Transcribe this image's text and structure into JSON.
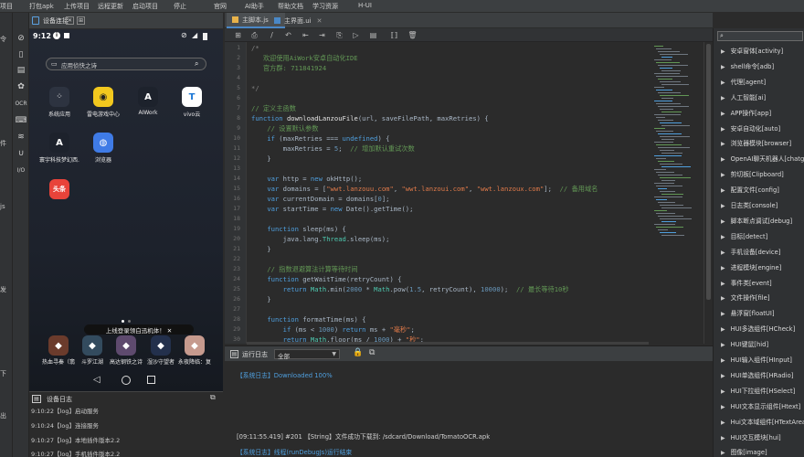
{
  "menubar": {
    "items": [
      "项目",
      "打包apk",
      "上传项目",
      "远程更新",
      "启动项目",
      "停止",
      "官网",
      "AI助手",
      "帮助文档",
      "学习资源",
      "H-UI"
    ]
  },
  "left_edge": [
    "令",
    "件",
    "js",
    "发",
    "下",
    "出"
  ],
  "device": {
    "tab_label": "设备连接",
    "status_time": "9:12",
    "search_placeholder": "应用侦快之诗",
    "apps": [
      {
        "label": "系统应用",
        "icon": "grid-icon",
        "color": "#2d3340"
      },
      {
        "label": "雷电游戏中心",
        "icon": "gamepad-icon",
        "color": "#f2c81e"
      },
      {
        "label": "AIWork",
        "icon": "avengers-icon",
        "color": "#1d222c"
      },
      {
        "label": "vivo云",
        "icon": "cloud-icon",
        "color": "#ffffff"
      },
      {
        "label": "寰宇科技梦幻西...",
        "icon": "avengers-icon",
        "color": "#1d222c"
      },
      {
        "label": "浏览器",
        "icon": "globe-icon",
        "color": "#3f7be6"
      },
      {
        "label": "",
        "icon": "toutiao-icon",
        "color": "#e8433a"
      }
    ],
    "toutiao_text": "头条",
    "dock_apps": [
      "热血寻秦（翡",
      "斗罗江湖",
      "高达钢铁之诗",
      "湿沙守望者",
      "永夜降临：复"
    ],
    "toast": "上线登录领白迅机体！ ✕",
    "log": {
      "title": "设备日志",
      "rows": [
        "9:10:22【log】启动服务",
        "9:10:24【log】连接服务",
        "9:10:27【log】本地插件版本2.2",
        "9:10:27【log】手机插件版本2.2"
      ]
    }
  },
  "editor": {
    "tabs": [
      {
        "label": "主脚本.js",
        "active": true
      },
      {
        "label": "主界面.ui",
        "active": false
      }
    ],
    "line_numbers": [
      "1",
      "2",
      "3",
      "4",
      "5",
      "6",
      "7",
      "8",
      "9",
      "10",
      "11",
      "12",
      "13",
      "14",
      "15",
      "16",
      "17",
      "18",
      "19",
      "20",
      "21",
      "22",
      "23",
      "24",
      "25",
      "26",
      "27",
      "28",
      "29",
      "30"
    ]
  },
  "runlog": {
    "title": "运行日志",
    "filter": "全部",
    "lines": [
      {
        "text": "【系统日志】Downloaded 100%",
        "color": "#4f9fde"
      },
      {
        "text": "[09:11:55.419]  #201 【String】文件成功下载到: /sdcard/Download/TomatoOCR.apk",
        "color": "#d0d0d0"
      },
      {
        "text": "【系统日志】线程(runDebugJs)运行结束",
        "color": "#4f9fde"
      }
    ]
  },
  "modules": {
    "items": [
      "安卓窗体[activity]",
      "shell命令[adb]",
      "代理[agent]",
      "人工智能[ai]",
      "APP操作[app]",
      "安卓自动化[auto]",
      "浏览器模块[browser]",
      "OpenAI聊天机器人[chatgpt]",
      "剪切板[Clipboard]",
      "配置文件[config]",
      "日志类[console]",
      "脚本断点调试[debug]",
      "目标[detect]",
      "手机设备[device]",
      "进程模块[engine]",
      "事件类[event]",
      "文件操作[file]",
      "悬浮窗[floatUI]",
      "HUI多选组件[HCheck]",
      "HUI键鼠[hid]",
      "HUI输入组件[HInput]",
      "HUI单选组件[HRadio]",
      "HUI下拉组件[HSelect]",
      "HUI文本显示组件[Htext]",
      "Hui文本域组件[HTextArea]",
      "HUI交互模块[hui]",
      "图像[image]"
    ]
  }
}
